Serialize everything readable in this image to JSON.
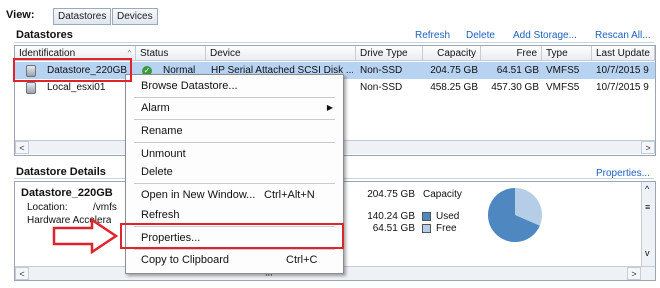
{
  "view": {
    "label": "View:",
    "datastores_btn": "Datastores",
    "devices_btn": "Devices"
  },
  "datastores": {
    "title": "Datastores",
    "actions": [
      "Refresh",
      "Delete",
      "Add Storage...",
      "Rescan All..."
    ],
    "columns": [
      "Identification",
      "Status",
      "Device",
      "Drive Type",
      "Capacity",
      "Free",
      "Type",
      "Last Update"
    ],
    "rows": [
      {
        "identification": "Datastore_220GB",
        "status": "Normal",
        "device": "HP Serial Attached SCSI Disk ...",
        "drive_type": "Non-SSD",
        "capacity": "204.75 GB",
        "free": "64.51 GB",
        "type": "VMFS5",
        "last_update": "10/7/2015 9"
      },
      {
        "identification": "Local_esxi01",
        "status": "",
        "device": "",
        "drive_type": "Non-SSD",
        "capacity": "458.25 GB",
        "free": "457.30 GB",
        "type": "VMFS5",
        "last_update": "10/7/2015 9"
      }
    ]
  },
  "details": {
    "title": "Datastore Details",
    "properties_link": "Properties...",
    "name": "Datastore_220GB",
    "location_label": "Location:",
    "location_value": "/vmfs",
    "hw_accel_label": "Hardware Accelera",
    "capacity_value": "204.75 GB",
    "capacity_label": "Capacity",
    "used_value": "140.24 GB",
    "used_label": "Used",
    "free_value": "64.51 GB",
    "free_label": "Free",
    "used_fraction": 0.685,
    "used_color": "#4f88c1",
    "free_color": "#b5cde6"
  },
  "context_menu": {
    "browse": "Browse Datastore...",
    "alarm": "Alarm",
    "rename": "Rename",
    "unmount": "Unmount",
    "delete": "Delete",
    "open_new_window": "Open in New Window...",
    "open_new_window_shortcut": "Ctrl+Alt+N",
    "refresh": "Refresh",
    "properties": "Properties...",
    "copy": "Copy to Clipboard",
    "copy_shortcut": "Ctrl+C"
  },
  "scroll_middle": "III",
  "icons": [
    "datastore-icon",
    "normal-status-icon",
    "submenu-arrow-icon",
    "red-arrow-icon",
    "pie-chart"
  ],
  "accent_color": "#e0242c"
}
